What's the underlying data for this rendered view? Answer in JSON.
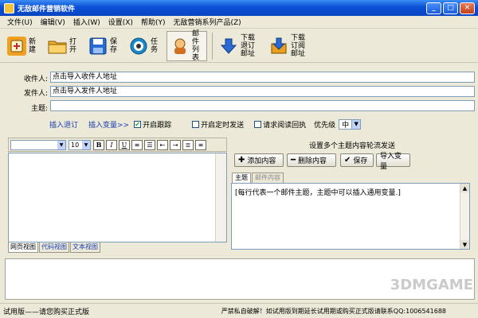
{
  "window": {
    "title": "无敌邮件营销软件"
  },
  "menu": [
    "文件(U)",
    "编辑(V)",
    "插入(W)",
    "设置(X)",
    "帮助(Y)",
    "无敌营销系列产品(Z)"
  ],
  "toolbar": [
    {
      "label": "新建",
      "icon": "new-icon",
      "color": "#f0a020"
    },
    {
      "label": "打开",
      "icon": "folder-icon",
      "color": "#f0b030"
    },
    {
      "label": "保存",
      "icon": "save-icon",
      "color": "#2a6ad4"
    },
    {
      "label": "任务",
      "icon": "task-icon",
      "color": "#1d88c9"
    },
    {
      "label": "邮件列表",
      "icon": "mail-list-icon",
      "color": "#d07020"
    },
    {
      "label": "下载退订邮址",
      "icon": "download-icon",
      "color": "#2a6ad4"
    },
    {
      "label": "下载订阅邮址",
      "icon": "download-sub-icon",
      "color": "#e9a021"
    }
  ],
  "form": {
    "recipient_label": "收件人:",
    "recipient_value": "点击导入收件人地址",
    "sender_label": "发件人:",
    "sender_value": "点击导入发件人地址",
    "subject_label": "主题:",
    "subject_value": ""
  },
  "options": {
    "insert_unsub": "插入退订",
    "insert_var": "插入变量>>",
    "track_label": "开启跟踪",
    "track_checked": true,
    "timed_label": "开启定时发送",
    "timed_checked": false,
    "receipt_label": "请求阅读回执",
    "receipt_checked": false,
    "priority_label": "优先级",
    "priority_value": "中"
  },
  "editor": {
    "font_size": "10",
    "view_tabs": [
      "网页视图",
      "代码视图",
      "文本视图"
    ]
  },
  "subject_panel": {
    "title": "设置多个主题内容轮流发送",
    "add_label": "添加内容",
    "delete_label": "删除内容",
    "save_label": "保存",
    "import_label": "导入变量",
    "tabs": [
      "主题",
      "邮件内容"
    ],
    "hint": "[每行代表一个邮件主题，主题中可以插入通用变量.]"
  },
  "status": {
    "left": "试用版——请您购买正式版",
    "right": "严禁私自破解！如试用版到期延长试用期或购买正式版请联系QQ:1006541688"
  },
  "watermark": "3DMGAME"
}
